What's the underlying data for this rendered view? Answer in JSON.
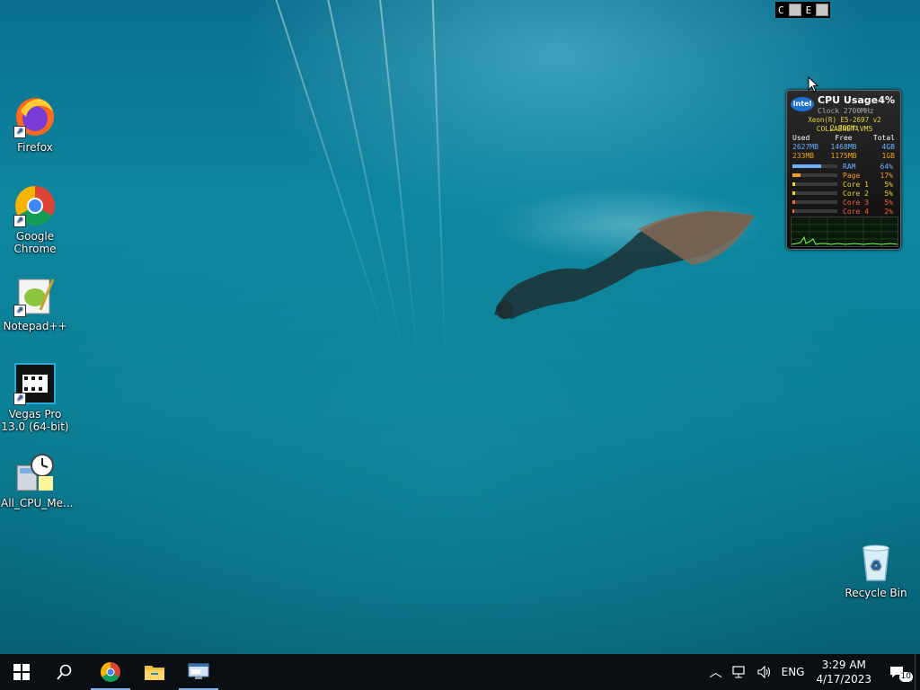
{
  "desktop": {
    "icons": [
      {
        "label": "Firefox",
        "icon": "firefox-icon"
      },
      {
        "label": "Google Chrome",
        "icon": "chrome-icon"
      },
      {
        "label": "Notepad++",
        "icon": "notepadplusplus-icon"
      },
      {
        "label": "Vegas Pro 13.0 (64-bit)",
        "icon": "vegas-pro-icon"
      },
      {
        "label": "All_CPU_Me...",
        "icon": "cpu-meter-icon"
      },
      {
        "label": "Recycle Bin",
        "icon": "recycle-bin-icon"
      }
    ]
  },
  "mini_bar": {
    "left": "C",
    "right": "E"
  },
  "cpu_gadget": {
    "brand": "intel",
    "title": "CPU Usage",
    "usage_pct": "4%",
    "clock": "Clock 2700MHz",
    "model": "Xeon(R) E5-2697 v2 2.70GHz",
    "host": "COLLABNET\\VM5",
    "mem_header": [
      "Used",
      "Free",
      "Total"
    ],
    "mem_rows": [
      [
        "2627MB",
        "1468MB",
        "4GB"
      ],
      [
        "233MB",
        "1175MB",
        "1GB"
      ]
    ],
    "bars": [
      {
        "label": "RAM",
        "value": "64%",
        "fraction": 0.64,
        "color": "#6ab0ff"
      },
      {
        "label": "Page",
        "value": "17%",
        "fraction": 0.17,
        "color": "#f0a020"
      },
      {
        "label": "Core 1",
        "value": "5%",
        "fraction": 0.05,
        "color": "#f0d020"
      },
      {
        "label": "Core 2",
        "value": "5%",
        "fraction": 0.05,
        "color": "#f0d020"
      },
      {
        "label": "Core 3",
        "value": "5%",
        "fraction": 0.05,
        "color": "#ff6030"
      },
      {
        "label": "Core 4",
        "value": "2%",
        "fraction": 0.02,
        "color": "#ff6030"
      }
    ]
  },
  "taskbar": {
    "start_icon": "windows-start-icon",
    "search_icon": "search-icon",
    "pinned": [
      {
        "name": "chrome",
        "icon": "chrome-icon",
        "active": true
      },
      {
        "name": "file-explorer",
        "icon": "folder-icon",
        "active": false
      },
      {
        "name": "remote-app",
        "icon": "monitor-window-icon",
        "active": true
      }
    ],
    "tray": {
      "language": "ENG",
      "time": "3:29 AM",
      "date": "4/17/2023",
      "notification_count": "10"
    }
  },
  "colors": {
    "taskbar": "#0a0f14",
    "accent": "#7fb3e6",
    "intel_yellow": "#e8d23a"
  }
}
